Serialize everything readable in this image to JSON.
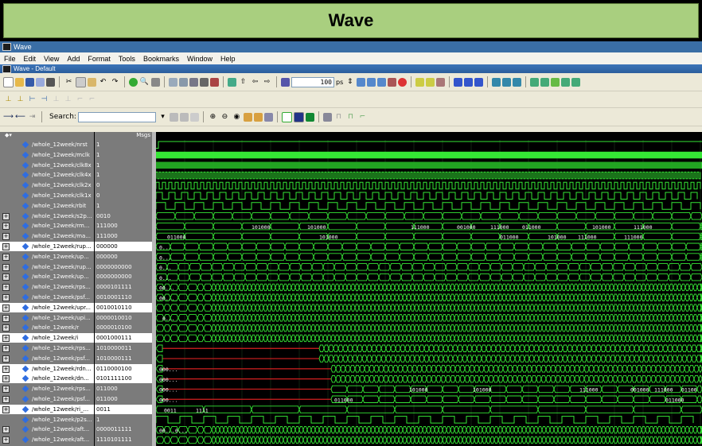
{
  "banner": {
    "title": "Wave"
  },
  "window": {
    "title": "Wave",
    "pane_title": "Wave - Default"
  },
  "menu": [
    "File",
    "Edit",
    "View",
    "Add",
    "Format",
    "Tools",
    "Bookmarks",
    "Window",
    "Help"
  ],
  "toolbar": {
    "time_value": "100",
    "time_unit": "ps",
    "search_label": "Search:",
    "search_placeholder": ""
  },
  "columns": {
    "msgs": "Msgs"
  },
  "signals": [
    {
      "name": "/whole_12week/nrst",
      "value": "1",
      "bus": false,
      "kind": "const"
    },
    {
      "name": "/whole_12week/mclk",
      "value": "1",
      "bus": false,
      "kind": "solid"
    },
    {
      "name": "/whole_12week/clk8x",
      "value": "1",
      "bus": false,
      "kind": "solid2"
    },
    {
      "name": "/whole_12week/clk4x",
      "value": "1",
      "bus": false,
      "kind": "clk",
      "period": 4
    },
    {
      "name": "/whole_12week/clk2x",
      "value": "0",
      "bus": false,
      "kind": "clk",
      "period": 8
    },
    {
      "name": "/whole_12week/clk1x",
      "value": "0",
      "bus": false,
      "kind": "clk",
      "period": 16
    },
    {
      "name": "/whole_12week/rbit",
      "value": "1",
      "bus": false,
      "kind": "clk",
      "period": 24
    },
    {
      "name": "/whole_12week/s2p...",
      "value": "0010",
      "bus": true,
      "kind": "bus",
      "period": 24,
      "labels": []
    },
    {
      "name": "/whole_12week/rm...",
      "value": "111000",
      "bus": true,
      "kind": "bus",
      "period": 36,
      "labels": [
        [
          "101000",
          120
        ],
        [
          "101000",
          190
        ],
        [
          "111000",
          320
        ],
        [
          "001000",
          378
        ],
        [
          "111000",
          420
        ],
        [
          "011000",
          460
        ],
        [
          "101000",
          548
        ],
        [
          "111000",
          600
        ]
      ]
    },
    {
      "name": "/whole_12week/ma...",
      "value": "111000",
      "bus": true,
      "kind": "bus",
      "period": 36,
      "labels": [
        [
          "011000",
          14
        ],
        [
          "101000",
          205
        ],
        [
          "011000",
          432
        ],
        [
          "101000",
          492
        ],
        [
          "111000",
          530
        ],
        [
          "111000",
          588
        ]
      ]
    },
    {
      "name": "/whole_12week/rup...",
      "value": "000000",
      "bus": true,
      "kind": "bus",
      "period": 18,
      "labels": [
        [
          "0...",
          4
        ]
      ],
      "sel": true
    },
    {
      "name": "/whole_12week/up...",
      "value": "000000",
      "bus": true,
      "kind": "bus",
      "period": 18,
      "labels": [
        [
          "0...",
          4
        ]
      ]
    },
    {
      "name": "/whole_12week/rup...",
      "value": "0000000000",
      "bus": true,
      "kind": "bus",
      "period": 14,
      "labels": [
        [
          "0...",
          4
        ]
      ]
    },
    {
      "name": "/whole_12week/up...",
      "value": "0000000000",
      "bus": true,
      "kind": "bus",
      "period": 14,
      "labels": [
        [
          "0...",
          4
        ]
      ]
    },
    {
      "name": "/whole_12week/rps...",
      "value": "0000101111",
      "bus": true,
      "kind": "busdense",
      "labels": [
        [
          "00...",
          4
        ]
      ]
    },
    {
      "name": "/whole_12week/psf...",
      "value": "0010001110",
      "bus": true,
      "kind": "busdense",
      "labels": [
        [
          "00...",
          4
        ]
      ]
    },
    {
      "name": "/whole_12week/upr...",
      "value": "0010010110",
      "bus": true,
      "kind": "busdense",
      "labels": [],
      "sel": true
    },
    {
      "name": "/whole_12week/upi...",
      "value": "0000010010",
      "bus": true,
      "kind": "busdense",
      "labels": [
        [
          "0...",
          8
        ]
      ]
    },
    {
      "name": "/whole_12week/r",
      "value": "0000010100",
      "bus": true,
      "kind": "busdense",
      "labels": []
    },
    {
      "name": "/whole_12week/i",
      "value": "0001000111",
      "bus": true,
      "kind": "busdense",
      "labels": [],
      "sel": true
    },
    {
      "name": "/whole_12week/rps...",
      "value": "1010000011",
      "bus": true,
      "kind": "busred",
      "start": 205
    },
    {
      "name": "/whole_12week/psf...",
      "value": "1010000111",
      "bus": true,
      "kind": "busred",
      "start": 205
    },
    {
      "name": "/whole_12week/rdn...",
      "value": "0110000100",
      "bus": true,
      "kind": "busred",
      "start": 220,
      "labels": [
        [
          "000...",
          4
        ]
      ],
      "sel": true
    },
    {
      "name": "/whole_12week/dn...",
      "value": "0101111100",
      "bus": true,
      "kind": "busred",
      "start": 220,
      "labels": [
        [
          "000...",
          4
        ]
      ],
      "sel": true
    },
    {
      "name": "/whole_12week/rps...",
      "value": "011000",
      "bus": true,
      "kind": "busred2",
      "start": 220,
      "labels": [
        [
          "000...",
          4
        ],
        [
          "101000",
          318
        ],
        [
          "101000",
          398
        ],
        [
          "111000",
          532
        ],
        [
          "001000",
          596
        ],
        [
          "111000",
          626
        ],
        [
          "01100",
          660
        ]
      ]
    },
    {
      "name": "/whole_12week/psf...",
      "value": "011000",
      "bus": true,
      "kind": "busred2",
      "start": 220,
      "labels": [
        [
          "000...",
          4
        ],
        [
          "011000",
          224
        ],
        [
          "011000",
          640
        ]
      ]
    },
    {
      "name": "/whole_12week/ri_...",
      "value": "0011",
      "bus": true,
      "kind": "bus",
      "period": 60,
      "labels": [
        [
          "0011",
          10
        ],
        [
          "1111",
          50
        ]
      ],
      "sel": true
    },
    {
      "name": "/whole_12week/p2s...",
      "value": "1",
      "bus": false,
      "kind": "clk",
      "period": 30
    },
    {
      "name": "/whole_12week/aft...",
      "value": "0000011111",
      "bus": true,
      "kind": "busdense",
      "labels": [
        [
          "00...",
          4
        ],
        [
          "0...",
          24
        ]
      ]
    },
    {
      "name": "/whole_12week/aft...",
      "value": "1110101111",
      "bus": true,
      "kind": "busdense",
      "labels": []
    }
  ]
}
